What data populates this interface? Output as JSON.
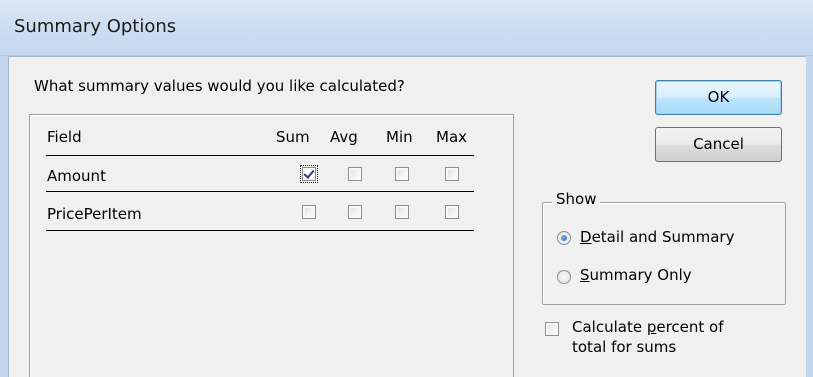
{
  "window": {
    "title": "Summary Options"
  },
  "prompt": "What summary values would you like calculated?",
  "columns": [
    "Field",
    "Sum",
    "Avg",
    "Min",
    "Max"
  ],
  "rows": [
    {
      "field": "Amount",
      "sum": true,
      "avg": false,
      "min": false,
      "max": false
    },
    {
      "field": "PricePerItem",
      "sum": false,
      "avg": false,
      "min": false,
      "max": false
    }
  ],
  "buttons": {
    "ok": "OK",
    "cancel": "Cancel"
  },
  "show_group": {
    "title": "Show",
    "options": [
      {
        "accel": "D",
        "rest": "etail and Summary",
        "selected": true
      },
      {
        "accel": "S",
        "rest": "ummary Only",
        "selected": false
      }
    ]
  },
  "percent_option": {
    "line1_pre": "Calculate ",
    "line1_accel": "p",
    "line1_post": "ercent of",
    "line2": "total for sums",
    "checked": false
  }
}
